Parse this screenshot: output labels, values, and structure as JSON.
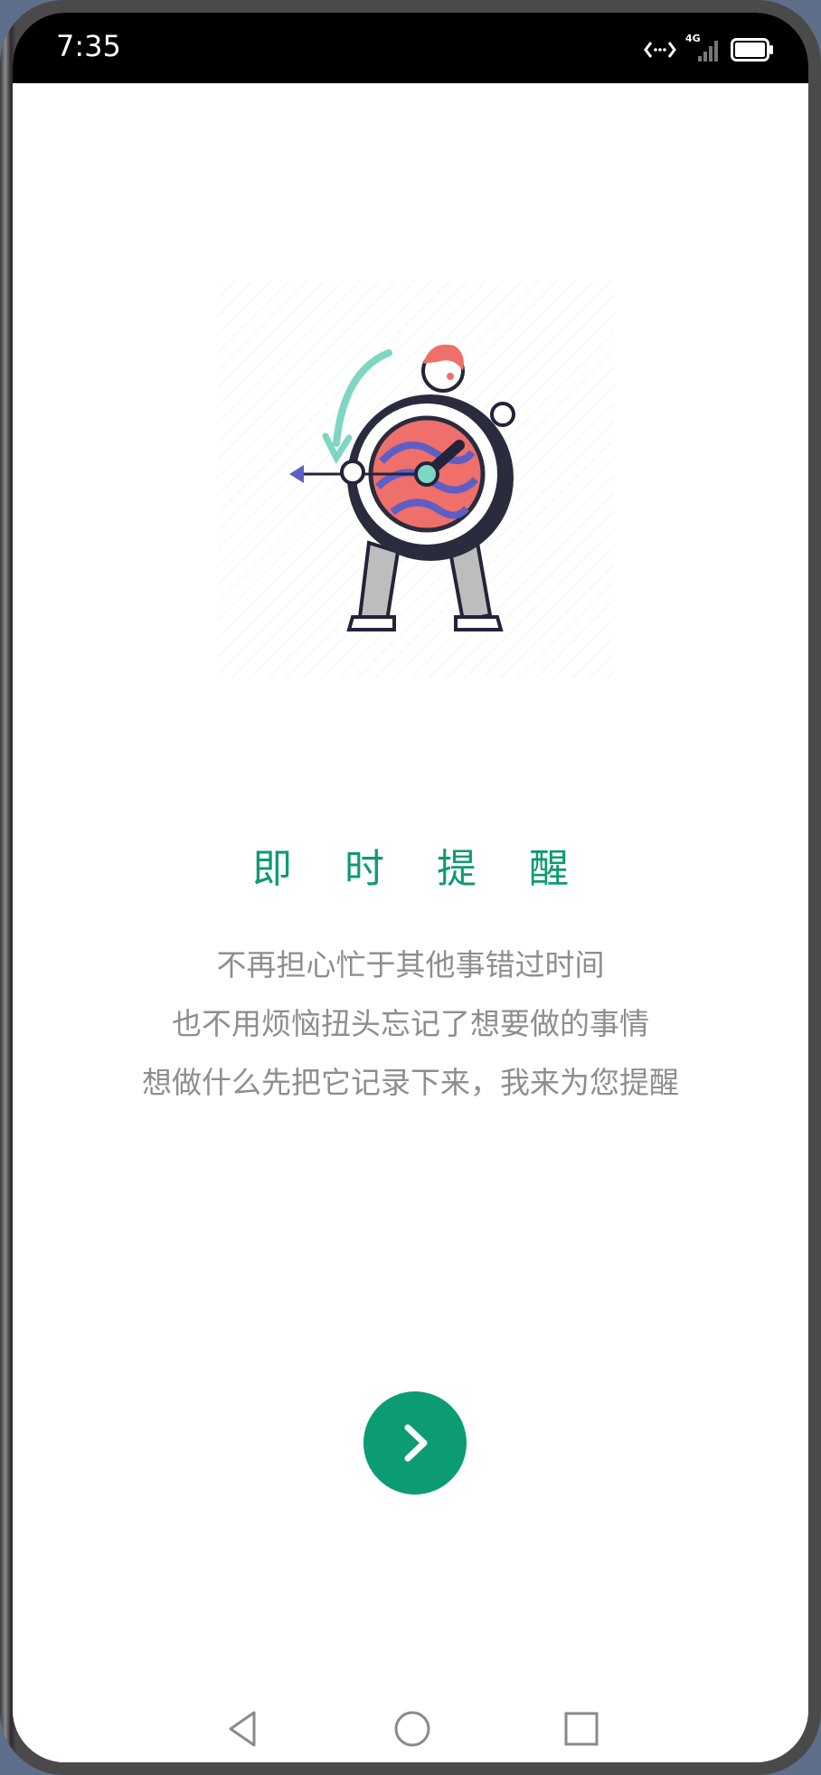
{
  "status_bar": {
    "time": "7:35",
    "network": "4G",
    "icons": [
      "data-transfer-icon",
      "signal-icon",
      "battery-icon"
    ]
  },
  "onboarding": {
    "title": "即 时 提 醒",
    "lines": [
      "不再担心忙于其他事错过时间",
      "也不用烦恼扭头忘记了想要做的事情",
      "想做什么先把它记录下来，我来为您提醒"
    ],
    "next_icon": "chevron-right-icon"
  },
  "nav_bar": {
    "icons": [
      "back-icon",
      "home-icon",
      "recents-icon"
    ]
  },
  "colors": {
    "accent": "#0c9c73",
    "title": "#0f9a74",
    "text": "#8e8e8e"
  }
}
